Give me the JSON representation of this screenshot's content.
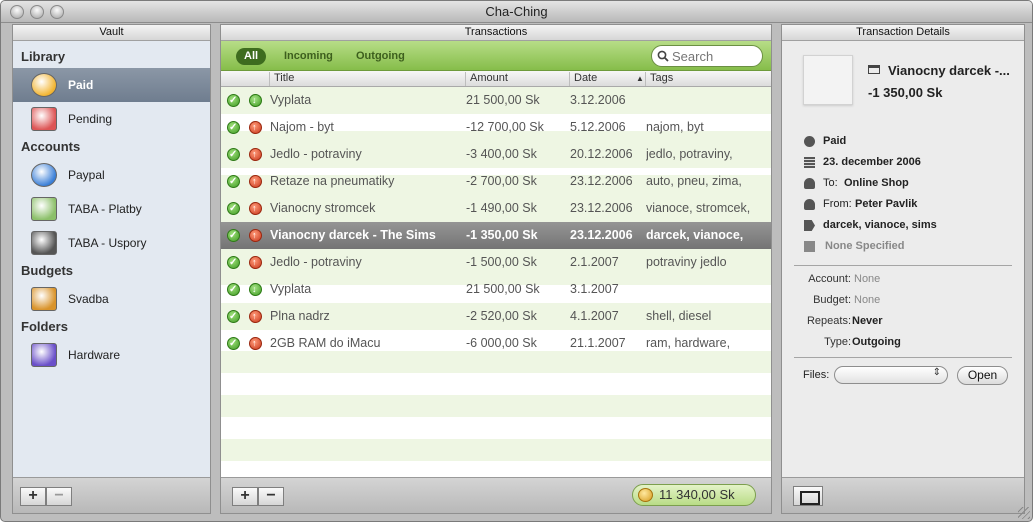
{
  "window": {
    "title": "Cha-Ching"
  },
  "vault": {
    "header": "Vault",
    "sections": [
      {
        "title": "Library",
        "items": [
          {
            "label": "Paid",
            "icon": "paid-coin-icon",
            "selected": true
          },
          {
            "label": "Pending",
            "icon": "calendar-icon"
          }
        ]
      },
      {
        "title": "Accounts",
        "items": [
          {
            "label": "Paypal",
            "icon": "globe-icon"
          },
          {
            "label": "TABA - Platby",
            "icon": "banknote-icon"
          },
          {
            "label": "TABA - Uspory",
            "icon": "safe-icon"
          }
        ]
      },
      {
        "title": "Budgets",
        "items": [
          {
            "label": "Svadba",
            "icon": "scales-icon"
          }
        ]
      },
      {
        "title": "Folders",
        "items": [
          {
            "label": "Hardware",
            "icon": "folder-icon"
          }
        ]
      }
    ],
    "add_label": "+",
    "remove_label": "−"
  },
  "transactions": {
    "header": "Transactions",
    "filters": [
      "All",
      "Incoming",
      "Outgoing"
    ],
    "active_filter": "All",
    "search_placeholder": "Search",
    "columns": [
      "Title",
      "Amount",
      "Date",
      "Tags"
    ],
    "sort_column": "Date",
    "rows": [
      {
        "direction": "in",
        "title": "Vyplata",
        "amount": "21 500,00 Sk",
        "date": "3.12.2006",
        "tags": ""
      },
      {
        "direction": "out",
        "title": "Najom - byt",
        "amount": "-12 700,00 Sk",
        "date": "5.12.2006",
        "tags": "najom, byt"
      },
      {
        "direction": "out",
        "title": "Jedlo - potraviny",
        "amount": "-3 400,00 Sk",
        "date": "20.12.2006",
        "tags": "jedlo, potraviny,"
      },
      {
        "direction": "out",
        "title": "Retaze na pneumatiky",
        "amount": "-2 700,00 Sk",
        "date": "23.12.2006",
        "tags": "auto, pneu, zima,"
      },
      {
        "direction": "out",
        "title": "Vianocny stromcek",
        "amount": "-1 490,00 Sk",
        "date": "23.12.2006",
        "tags": "vianoce, stromcek,"
      },
      {
        "direction": "out",
        "title": "Vianocny darcek - The Sims",
        "amount": "-1 350,00 Sk",
        "date": "23.12.2006",
        "tags": "darcek, vianoce,",
        "selected": true
      },
      {
        "direction": "out",
        "title": "Jedlo - potraviny",
        "amount": "-1 500,00 Sk",
        "date": "2.1.2007",
        "tags": "potraviny jedlo"
      },
      {
        "direction": "in",
        "title": "Vyplata",
        "amount": "21 500,00 Sk",
        "date": "3.1.2007",
        "tags": ""
      },
      {
        "direction": "out",
        "title": "Plna nadrz",
        "amount": "-2 520,00 Sk",
        "date": "4.1.2007",
        "tags": "shell, diesel"
      },
      {
        "direction": "out",
        "title": "2GB RAM do iMacu",
        "amount": "-6 000,00 Sk",
        "date": "21.1.2007",
        "tags": "ram, hardware,"
      }
    ],
    "total": "11 340,00 Sk",
    "add_label": "+",
    "remove_label": "−"
  },
  "details": {
    "header": "Transaction Details",
    "title": "Vianocny darcek -...",
    "amount": "-1 350,00 Sk",
    "status": "Paid",
    "date": "23. december 2006",
    "to_label": "To:",
    "to_value": "Online Shop",
    "from_label": "From:",
    "from_value": "Peter Pavlik",
    "tags": "darcek, vianoce, sims",
    "note": "None Specified",
    "account_label": "Account:",
    "account_value": "None",
    "budget_label": "Budget:",
    "budget_value": "None",
    "repeats_label": "Repeats:",
    "repeats_value": "Never",
    "type_label": "Type:",
    "type_value": "Outgoing",
    "files_label": "Files:",
    "open_label": "Open"
  }
}
